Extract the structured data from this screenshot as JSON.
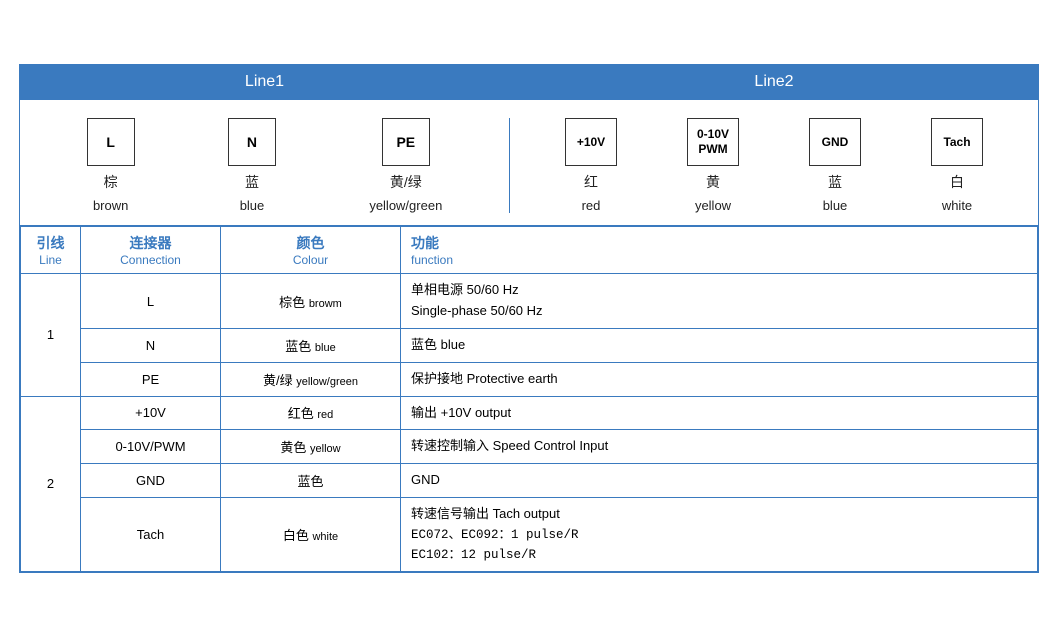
{
  "header": {
    "line1": "Line1",
    "line2": "Line2"
  },
  "diagram": {
    "line1_items": [
      {
        "box_label": "L",
        "zh": "棕",
        "en": "brown"
      },
      {
        "box_label": "N",
        "zh": "蓝",
        "en": "blue"
      },
      {
        "box_label": "PE",
        "zh": "黄/绿",
        "en": "yellow/green"
      }
    ],
    "line2_items": [
      {
        "box_label": "+10V",
        "zh": "红",
        "en": "red"
      },
      {
        "box_label": "0-10V\nPWM",
        "zh": "黄",
        "en": "yellow"
      },
      {
        "box_label": "GND",
        "zh": "蓝",
        "en": "blue"
      },
      {
        "box_label": "Tach",
        "zh": "白",
        "en": "white"
      }
    ]
  },
  "table": {
    "headers": {
      "line_zh": "引线",
      "line_en": "Line",
      "conn_zh": "连接器",
      "conn_en": "Connection",
      "color_zh": "颜色",
      "color_en": "Colour",
      "func_zh": "功能",
      "func_en": "function"
    },
    "rows": [
      {
        "line": "1",
        "rowspan": 3,
        "entries": [
          {
            "conn": "L",
            "color_zh": "棕色",
            "color_en": "browm",
            "func": "单相电源 50/60 Hz\nSingle-phase 50/60 Hz",
            "func_lines": [
              "单相电源 50/60 Hz",
              "Single-phase 50/60 Hz"
            ]
          },
          {
            "conn": "N",
            "color_zh": "蓝色",
            "color_en": "blue",
            "func_lines": [
              "蓝色 blue"
            ]
          },
          {
            "conn": "PE",
            "color_zh": "黄/绿",
            "color_en": "yellow/green",
            "func_lines": [
              "保护接地 Protective earth"
            ]
          }
        ]
      },
      {
        "line": "2",
        "rowspan": 4,
        "entries": [
          {
            "conn": "+10V",
            "color_zh": "红色",
            "color_en": "red",
            "func_lines": [
              "输出 +10V output"
            ]
          },
          {
            "conn": "0-10V/PWM",
            "color_zh": "黄色",
            "color_en": "yellow",
            "func_lines": [
              "转速控制输入 Speed Control Input"
            ]
          },
          {
            "conn": "GND",
            "color_zh": "蓝色",
            "color_en": "",
            "func_lines": [
              "GND"
            ]
          },
          {
            "conn": "Tach",
            "color_zh": "白色",
            "color_en": "white",
            "func_lines": [
              "转速信号输出 Tach output",
              "EC072、EC092：1 pulse/R",
              "EC102：12 pulse/R"
            ]
          }
        ]
      }
    ]
  }
}
